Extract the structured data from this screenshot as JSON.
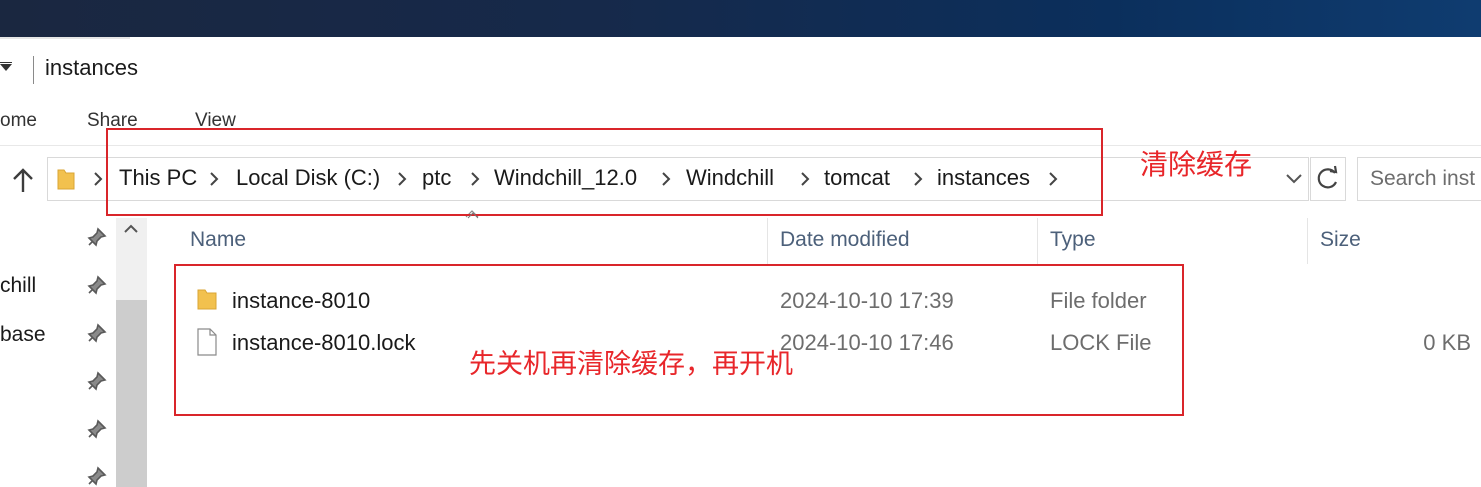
{
  "window": {
    "title": "instances"
  },
  "ribbon": {
    "tabs": [
      "ome",
      "Share",
      "View"
    ]
  },
  "address_bar": {
    "breadcrumbs": [
      "This PC",
      "Local Disk (C:)",
      "ptc",
      "Windchill_12.0",
      "Windchill",
      "tomcat",
      "instances"
    ]
  },
  "search": {
    "placeholder": "Search inst"
  },
  "nav_pane": {
    "items": [
      "chill",
      "base"
    ]
  },
  "columns": {
    "name": "Name",
    "date_modified": "Date modified",
    "type": "Type",
    "size": "Size"
  },
  "files": [
    {
      "name": "instance-8010",
      "date": "2024-10-10 17:39",
      "type": "File folder",
      "size": "",
      "icon": "folder-icon"
    },
    {
      "name": "instance-8010.lock",
      "date": "2024-10-10 17:46",
      "type": "LOCK File",
      "size": "0 KB",
      "icon": "file-icon"
    }
  ],
  "annotations": {
    "address_note": "清除缓存",
    "files_note": "先关机再清除缓存，再开机"
  },
  "colors": {
    "annotation_red": "#e8262a",
    "column_header": "#4c607a",
    "folder_yellow": "#f2c14e"
  }
}
